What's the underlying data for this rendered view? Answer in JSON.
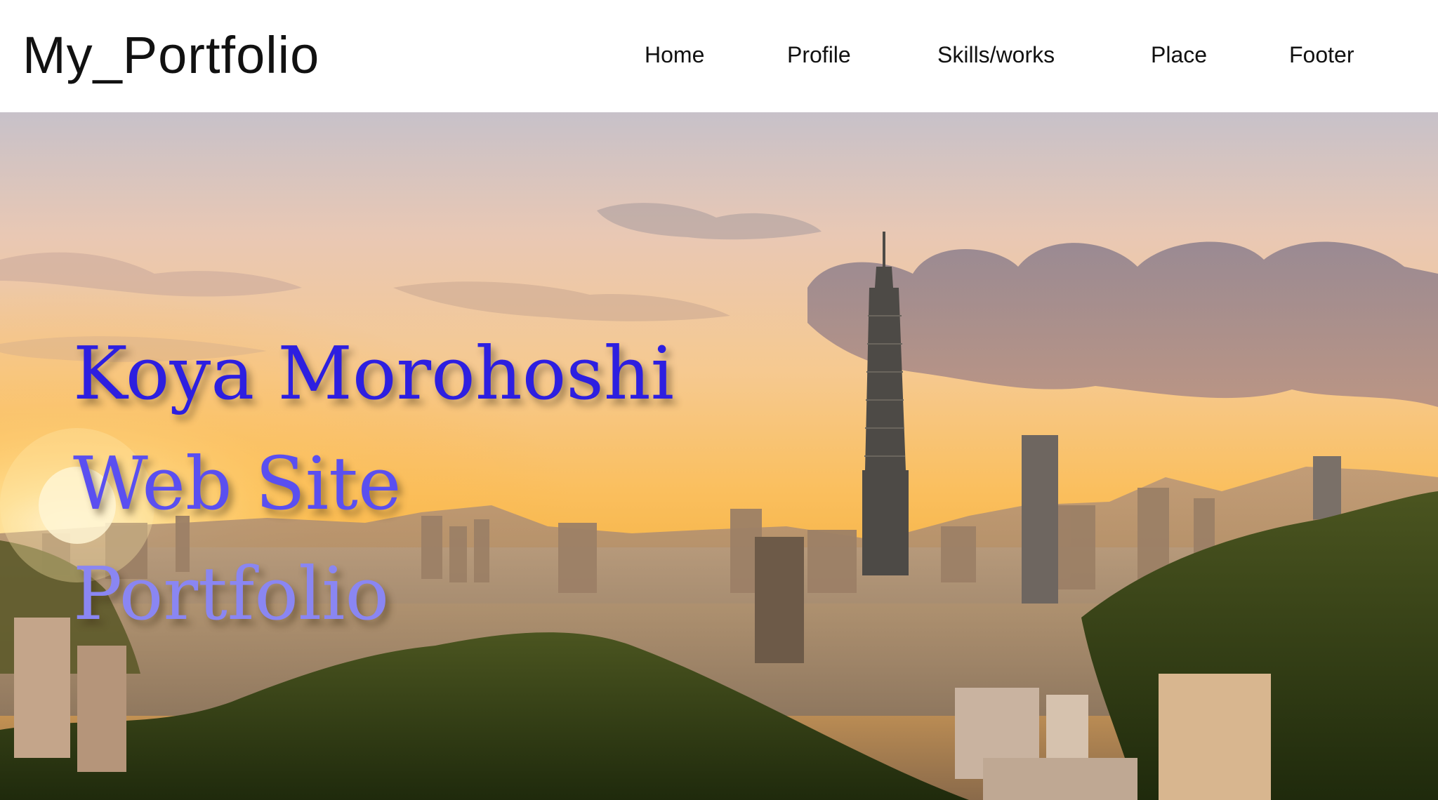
{
  "header": {
    "logo": "My_Portfolio",
    "nav": [
      {
        "label": "Home"
      },
      {
        "label": "Profile"
      },
      {
        "label": "Skills/works"
      },
      {
        "label": "Place"
      },
      {
        "label": "Footer"
      }
    ]
  },
  "hero": {
    "title_lines": [
      "Koya Morohoshi",
      "Web Site",
      "Portfolio"
    ],
    "background": "city-skyline-sunset-photo",
    "colors": {
      "line_1": "#2d1fe0",
      "line_2": "#5a4ff0",
      "line_3": "#8a86f2",
      "sky_top": "#b9b6c6",
      "sky_glow": "#f8b43a",
      "hills": "#2f3a16"
    }
  }
}
